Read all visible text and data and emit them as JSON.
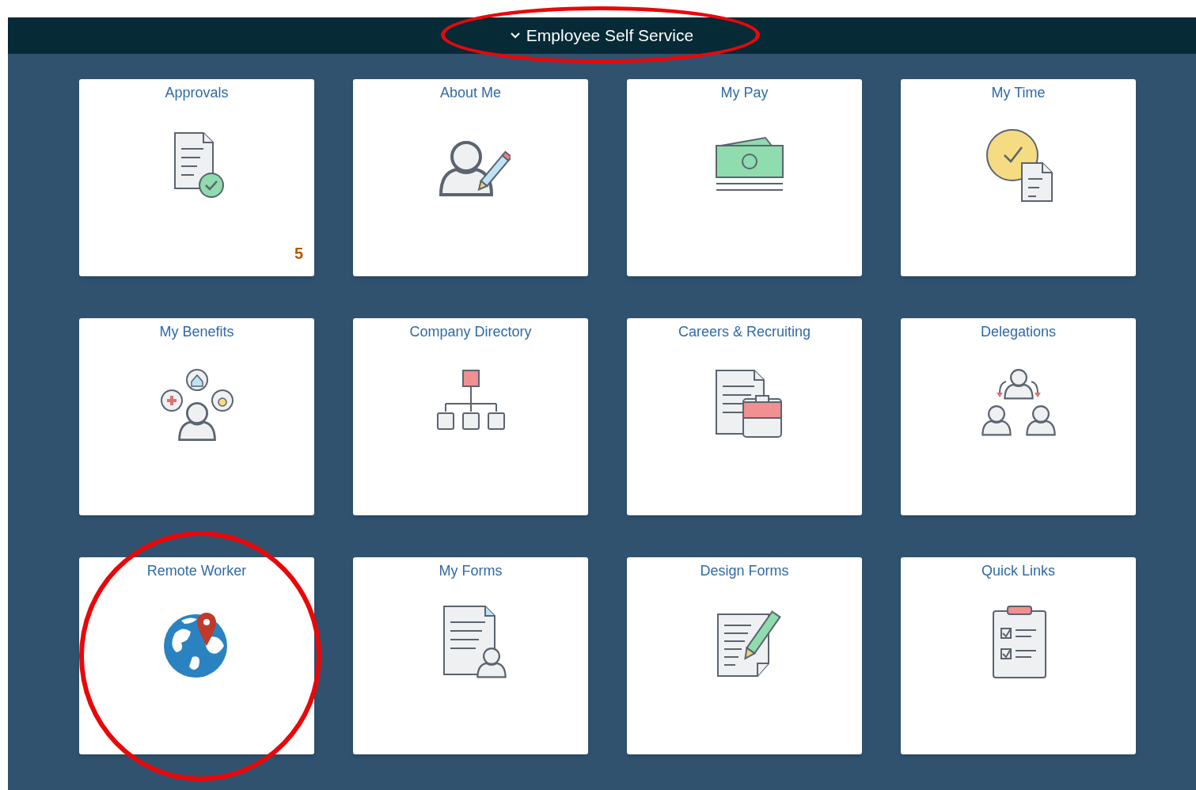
{
  "header": {
    "title": "Employee Self Service",
    "expanded": true,
    "highlighted": true
  },
  "tiles": [
    {
      "title": "Approvals",
      "kind": "approvals",
      "badge": "5",
      "highlighted": false
    },
    {
      "title": "About Me",
      "kind": "profile",
      "highlighted": false
    },
    {
      "title": "My Pay",
      "kind": "pay",
      "highlighted": false
    },
    {
      "title": "My Time",
      "kind": "time",
      "highlighted": false
    },
    {
      "title": "My Benefits",
      "kind": "benefits",
      "highlighted": false
    },
    {
      "title": "Company Directory",
      "kind": "directory",
      "highlighted": false
    },
    {
      "title": "Careers & Recruiting",
      "kind": "careers",
      "highlighted": false
    },
    {
      "title": "Delegations",
      "kind": "delegations",
      "highlighted": false
    },
    {
      "title": "Remote Worker",
      "kind": "remote",
      "highlighted": true
    },
    {
      "title": "My Forms",
      "kind": "forms",
      "highlighted": false
    },
    {
      "title": "Design Forms",
      "kind": "design",
      "highlighted": false
    },
    {
      "title": "Quick Links",
      "kind": "links",
      "highlighted": false
    }
  ]
}
